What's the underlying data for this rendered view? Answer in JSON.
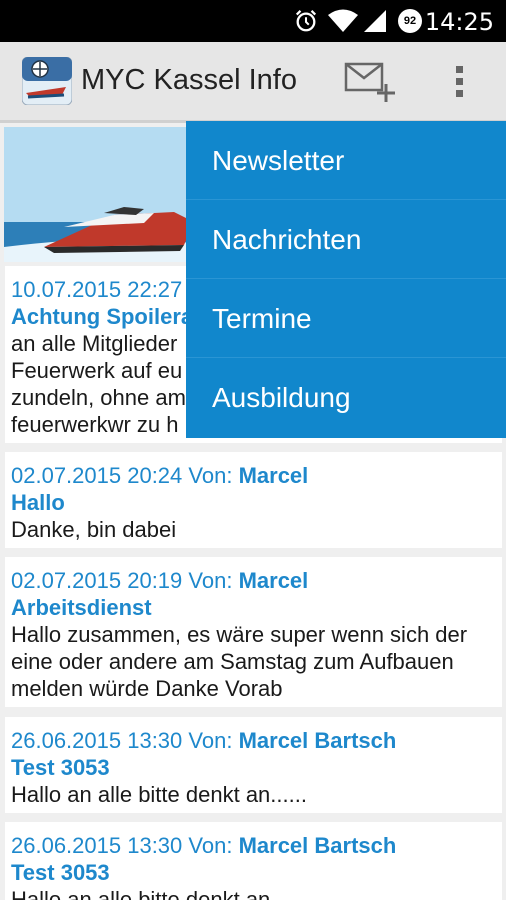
{
  "status": {
    "time": "14:25",
    "battery": "92"
  },
  "app": {
    "title": "MYC Kassel Info"
  },
  "menu": {
    "items": [
      "Newsletter",
      "Nachrichten",
      "Termine",
      "Ausbildung"
    ]
  },
  "messages": [
    {
      "date": "10.07.2015 22:27",
      "title": "Achtung Spoilera",
      "body": [
        "an alle Mitglieder",
        "Feuerwerk auf eu",
        "zundeln, ohne am",
        "feuerwerkwr zu h"
      ]
    },
    {
      "date": "02.07.2015 20:24",
      "from_label": "Von:",
      "author": "Marcel",
      "title": "Hallo",
      "body": [
        "Danke, bin dabei"
      ]
    },
    {
      "date": "02.07.2015 20:19",
      "from_label": "Von:",
      "author": "Marcel",
      "title": "Arbeitsdienst",
      "body": [
        "Hallo zusammen, es wäre super wenn sich der",
        "eine oder andere am Samstag zum Aufbauen",
        "melden würde Danke Vorab"
      ]
    },
    {
      "date": "26.06.2015 13:30",
      "from_label": "Von:",
      "author": "Marcel Bartsch",
      "title": "Test 3053",
      "body": [
        "Hallo an alle bitte denkt an......"
      ]
    },
    {
      "date": "26.06.2015 13:30",
      "from_label": "Von:",
      "author": "Marcel Bartsch",
      "title": "Test 3053",
      "body": [
        "Hallo an alle bitte denkt an......"
      ]
    }
  ]
}
